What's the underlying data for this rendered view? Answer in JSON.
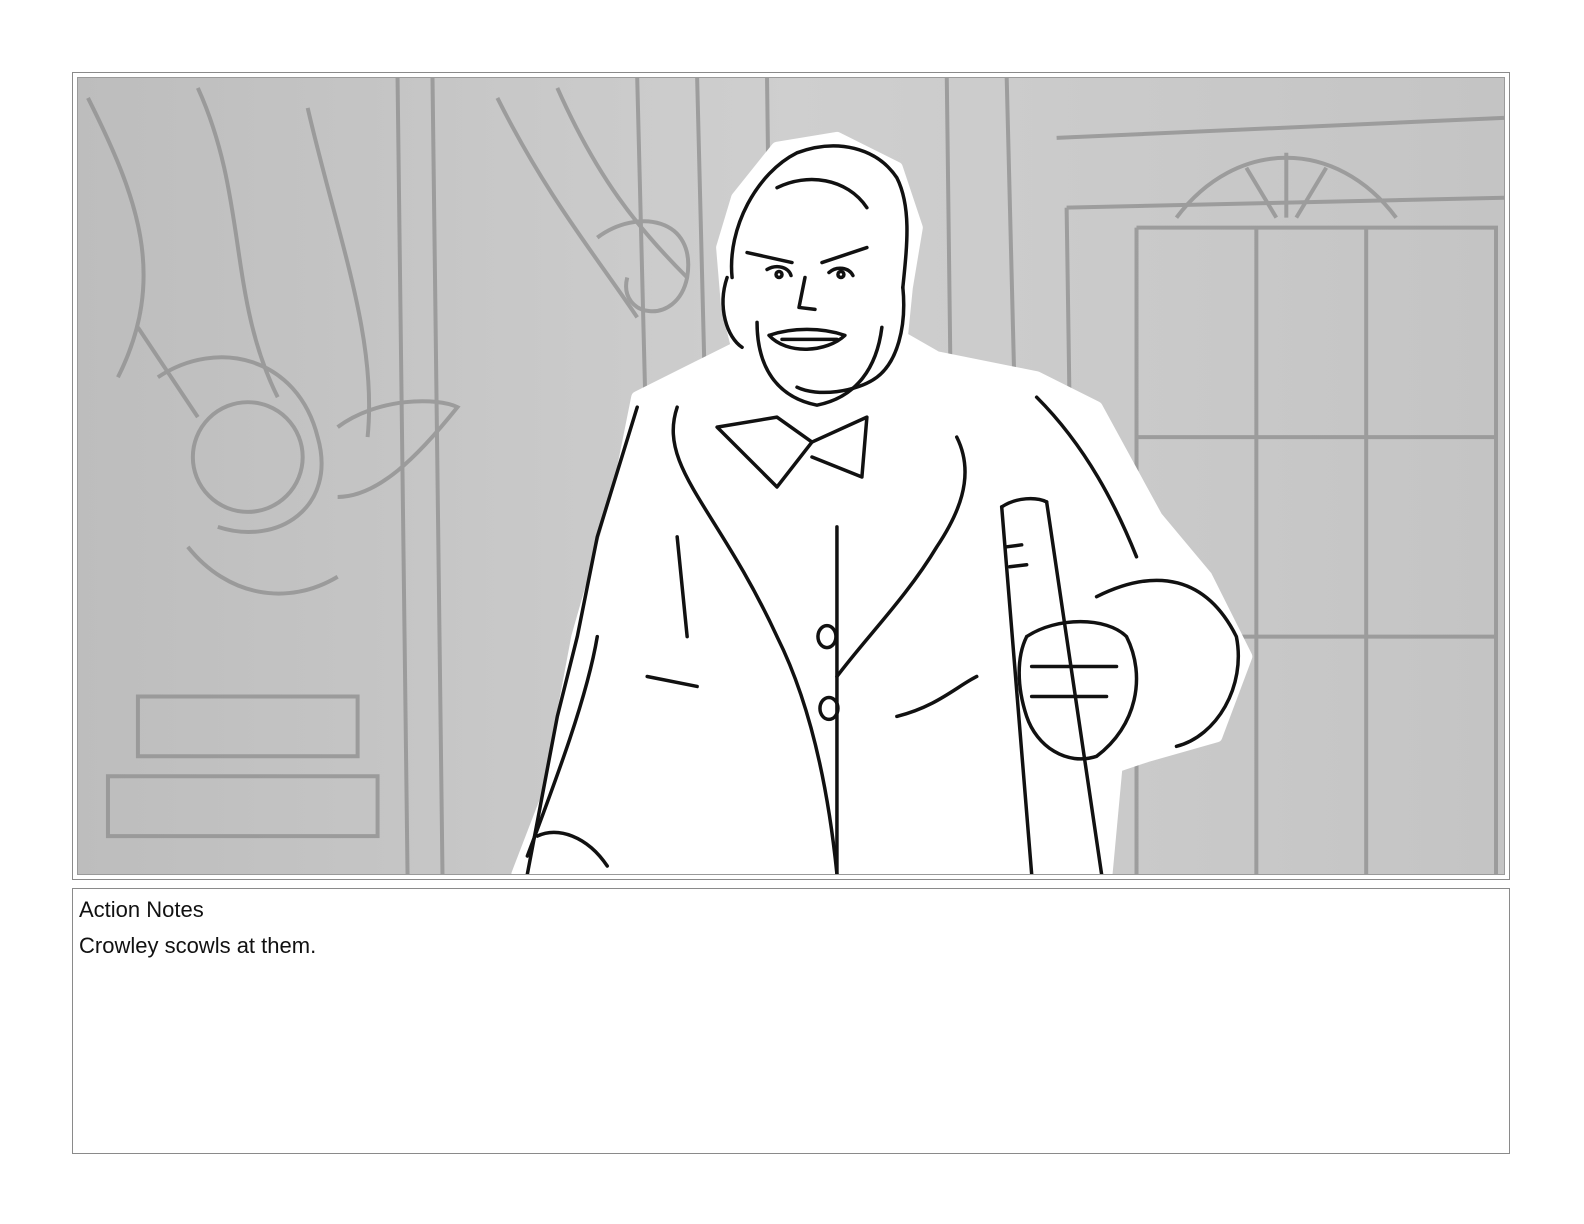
{
  "panel": {
    "illustration": "storyboard-sketch-icon"
  },
  "notes": {
    "heading": "Action Notes",
    "text": "Crowley scowls at them."
  }
}
